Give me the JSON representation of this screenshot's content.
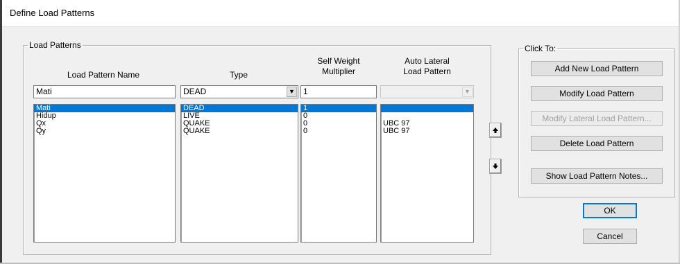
{
  "window": {
    "title": "Define Load Patterns"
  },
  "load_patterns": {
    "group_label": "Load Patterns",
    "headers": {
      "name": "Load Pattern Name",
      "type": "Type",
      "self_weight_line1": "Self Weight",
      "self_weight_line2": "Multiplier",
      "auto_lateral_line1": "Auto Lateral",
      "auto_lateral_line2": "Load Pattern"
    },
    "edit_row": {
      "name": "Mati",
      "type": "DEAD",
      "self_weight": "1",
      "auto_lateral": ""
    },
    "names": [
      "Mati",
      "Hidup",
      "Qx",
      "Qy"
    ],
    "types": [
      "DEAD",
      "LIVE",
      "QUAKE",
      "QUAKE"
    ],
    "multipliers": [
      "1",
      "0",
      "0",
      "0"
    ],
    "auto_lateral": [
      "",
      "",
      "UBC 97",
      "UBC 97"
    ],
    "selected_index": 0
  },
  "click_to": {
    "group_label": "Click To:",
    "buttons": {
      "add": "Add New Load Pattern",
      "modify": "Modify Load Pattern",
      "modify_lateral": "Modify Lateral Load Pattern...",
      "delete": "Delete Load Pattern",
      "notes": "Show Load Pattern Notes..."
    }
  },
  "dialog_buttons": {
    "ok": "OK",
    "cancel": "Cancel"
  },
  "icons": {
    "dropdown": "chevron-down-icon",
    "move_up": "arrow-up-icon",
    "move_down": "arrow-down-icon"
  },
  "colors": {
    "selection": "#0078d7",
    "disabled_text": "#a0a0a0"
  }
}
